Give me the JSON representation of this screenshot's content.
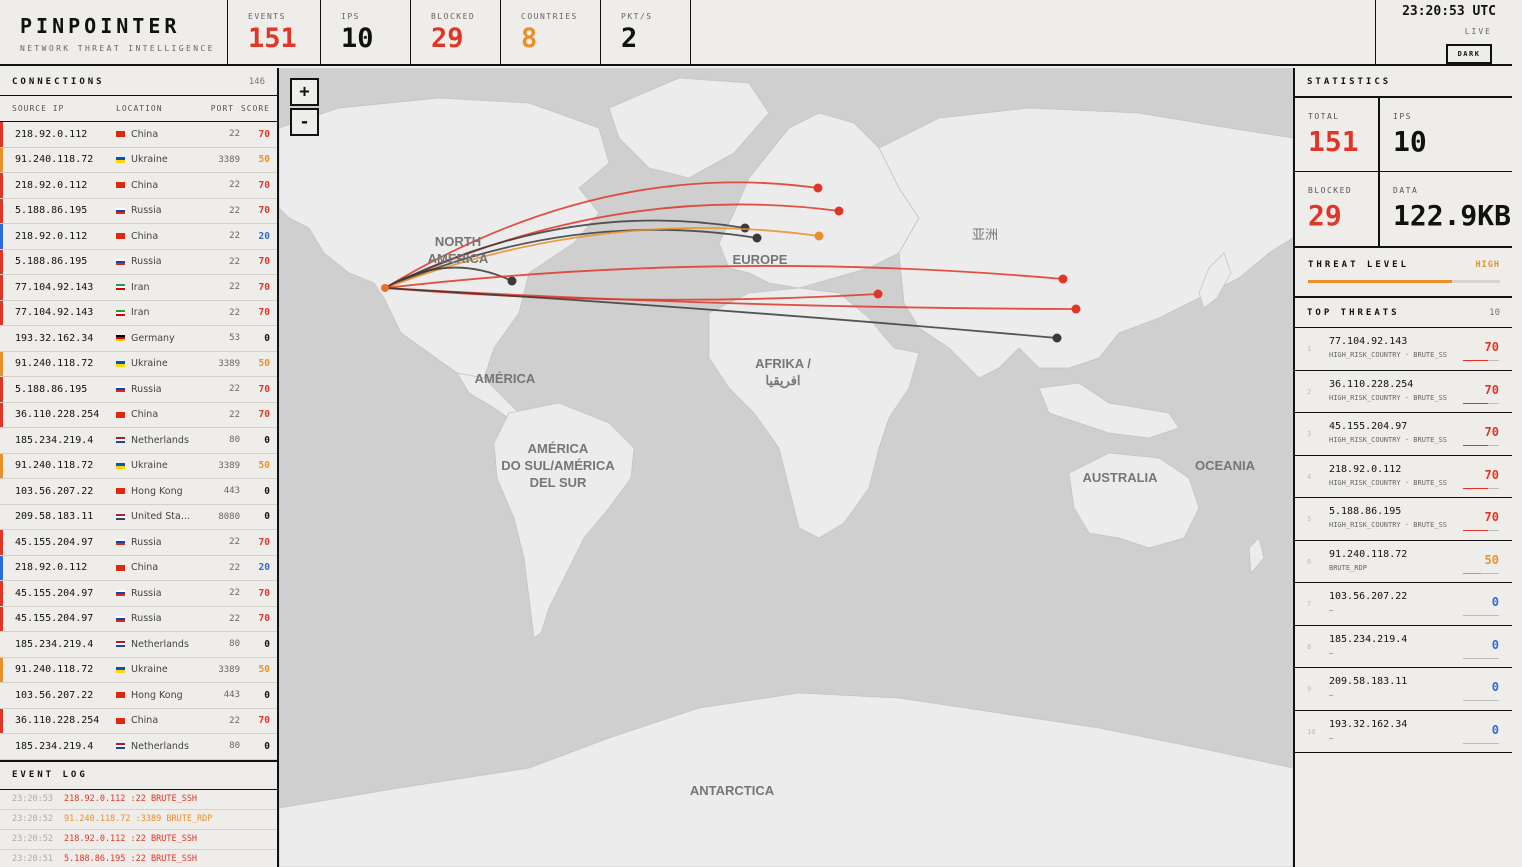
{
  "app": {
    "title": "PINPOINTER",
    "subtitle": "NETWORK THREAT INTELLIGENCE"
  },
  "header_stats": [
    {
      "label": "EVENTS",
      "value": "151",
      "color": "#e03527"
    },
    {
      "label": "IPS",
      "value": "10",
      "color": "#111111"
    },
    {
      "label": "BLOCKED",
      "value": "29",
      "color": "#e03527"
    },
    {
      "label": "COUNTRIES",
      "value": "8",
      "color": "#e8902a"
    },
    {
      "label": "PKT/S",
      "value": "2",
      "color": "#111111"
    }
  ],
  "clock": {
    "time": "23:20:53 UTC",
    "status": "LIVE",
    "theme_button": "DARK"
  },
  "connections": {
    "title": "CONNECTIONS",
    "count": "146",
    "columns": [
      "SOURCE IP",
      "LOCATION",
      "PORT",
      "SCORE"
    ],
    "rows": [
      {
        "ip": "218.92.0.112",
        "location": "China",
        "port": "22",
        "score": "70",
        "level": "high"
      },
      {
        "ip": "91.240.118.72",
        "location": "Ukraine",
        "port": "3389",
        "score": "50",
        "level": "med"
      },
      {
        "ip": "218.92.0.112",
        "location": "China",
        "port": "22",
        "score": "70",
        "level": "high"
      },
      {
        "ip": "5.188.86.195",
        "location": "Russia",
        "port": "22",
        "score": "70",
        "level": "high"
      },
      {
        "ip": "218.92.0.112",
        "location": "China",
        "port": "22",
        "score": "20",
        "level": "low"
      },
      {
        "ip": "5.188.86.195",
        "location": "Russia",
        "port": "22",
        "score": "70",
        "level": "high"
      },
      {
        "ip": "77.104.92.143",
        "location": "Iran",
        "port": "22",
        "score": "70",
        "level": "high"
      },
      {
        "ip": "77.104.92.143",
        "location": "Iran",
        "port": "22",
        "score": "70",
        "level": "high"
      },
      {
        "ip": "193.32.162.34",
        "location": "Germany",
        "port": "53",
        "score": "0",
        "level": "none"
      },
      {
        "ip": "91.240.118.72",
        "location": "Ukraine",
        "port": "3389",
        "score": "50",
        "level": "med"
      },
      {
        "ip": "5.188.86.195",
        "location": "Russia",
        "port": "22",
        "score": "70",
        "level": "high"
      },
      {
        "ip": "36.110.228.254",
        "location": "China",
        "port": "22",
        "score": "70",
        "level": "high"
      },
      {
        "ip": "185.234.219.4",
        "location": "Netherlands",
        "port": "80",
        "score": "0",
        "level": "none"
      },
      {
        "ip": "91.240.118.72",
        "location": "Ukraine",
        "port": "3389",
        "score": "50",
        "level": "med"
      },
      {
        "ip": "103.56.207.22",
        "location": "Hong Kong",
        "port": "443",
        "score": "0",
        "level": "none"
      },
      {
        "ip": "209.58.183.11",
        "location": "United Sta…",
        "port": "8080",
        "score": "0",
        "level": "none"
      },
      {
        "ip": "45.155.204.97",
        "location": "Russia",
        "port": "22",
        "score": "70",
        "level": "high"
      },
      {
        "ip": "218.92.0.112",
        "location": "China",
        "port": "22",
        "score": "20",
        "level": "low"
      },
      {
        "ip": "45.155.204.97",
        "location": "Russia",
        "port": "22",
        "score": "70",
        "level": "high"
      },
      {
        "ip": "45.155.204.97",
        "location": "Russia",
        "port": "22",
        "score": "70",
        "level": "high"
      },
      {
        "ip": "185.234.219.4",
        "location": "Netherlands",
        "port": "80",
        "score": "0",
        "level": "none"
      },
      {
        "ip": "91.240.118.72",
        "location": "Ukraine",
        "port": "3389",
        "score": "50",
        "level": "med"
      },
      {
        "ip": "103.56.207.22",
        "location": "Hong Kong",
        "port": "443",
        "score": "0",
        "level": "none"
      },
      {
        "ip": "36.110.228.254",
        "location": "China",
        "port": "22",
        "score": "70",
        "level": "high"
      },
      {
        "ip": "185.234.219.4",
        "location": "Netherlands",
        "port": "80",
        "score": "0",
        "level": "none"
      }
    ]
  },
  "event_log": {
    "title": "EVENT LOG",
    "rows": [
      {
        "time": "23:20:53",
        "text": "218.92.0.112 :22 BRUTE_SSH",
        "level": "high"
      },
      {
        "time": "23:20:52",
        "text": "91.240.118.72 :3389 BRUTE_RDP",
        "level": "med"
      },
      {
        "time": "23:20:52",
        "text": "218.92.0.112 :22 BRUTE_SSH",
        "level": "high"
      },
      {
        "time": "23:20:51",
        "text": "5.188.86.195 :22 BRUTE_SSH",
        "level": "high"
      }
    ]
  },
  "map": {
    "zoom_in": "+",
    "zoom_out": "-",
    "labels": {
      "north_america": [
        "NORTH",
        "AMERICA"
      ],
      "america": "AMÉRICA",
      "south_america": [
        "AMÉRICA",
        "DO SUL/AMÉRICA",
        "DEL SUR"
      ],
      "europe": "EUROPE",
      "africa": [
        "AFRIKA /",
        "افريقيا"
      ],
      "asia": "亚洲",
      "australia": "AUSTRALIA",
      "oceania": "OCEANIA",
      "antarctica": "ANTARCTICA"
    }
  },
  "statistics": {
    "title": "STATISTICS",
    "cells": [
      {
        "label": "TOTAL",
        "value": "151",
        "color": "#e03527"
      },
      {
        "label": "IPS",
        "value": "10",
        "color": "#111111"
      },
      {
        "label": "BLOCKED",
        "value": "29",
        "color": "#e03527"
      },
      {
        "label": "DATA",
        "value": "122.9KB",
        "color": "#111111"
      }
    ],
    "threat_level": {
      "label": "THREAT LEVEL",
      "value": "HIGH",
      "fill": 0.75,
      "color": "#e8902a"
    }
  },
  "top_threats": {
    "title": "TOP THREATS",
    "count": "10",
    "rows": [
      {
        "rank": "1",
        "ip": "77.104.92.143",
        "tags": "HIGH_RISK_COUNTRY · BRUTE_SSH",
        "score": "70",
        "level": "high"
      },
      {
        "rank": "2",
        "ip": "36.110.228.254",
        "tags": "HIGH_RISK_COUNTRY · BRUTE_SSH",
        "score": "70",
        "level": "high"
      },
      {
        "rank": "3",
        "ip": "45.155.204.97",
        "tags": "HIGH_RISK_COUNTRY · BRUTE_SSH",
        "score": "70",
        "level": "high"
      },
      {
        "rank": "4",
        "ip": "218.92.0.112",
        "tags": "HIGH_RISK_COUNTRY · BRUTE_SSH",
        "score": "70",
        "level": "high"
      },
      {
        "rank": "5",
        "ip": "5.188.86.195",
        "tags": "HIGH_RISK_COUNTRY · BRUTE_SSH",
        "score": "70",
        "level": "high"
      },
      {
        "rank": "6",
        "ip": "91.240.118.72",
        "tags": "BRUTE_RDP",
        "score": "50",
        "level": "med"
      },
      {
        "rank": "7",
        "ip": "103.56.207.22",
        "tags": "—",
        "score": "0",
        "level": "none"
      },
      {
        "rank": "8",
        "ip": "185.234.219.4",
        "tags": "—",
        "score": "0",
        "level": "none"
      },
      {
        "rank": "9",
        "ip": "209.58.183.11",
        "tags": "—",
        "score": "0",
        "level": "none"
      },
      {
        "rank": "10",
        "ip": "193.32.162.34",
        "tags": "—",
        "score": "0",
        "level": "none"
      }
    ]
  },
  "colors": {
    "high": "#e03527",
    "med": "#e8902a",
    "low": "#2c6bd8",
    "none": "#111111",
    "dark_arc": "#3a3a3a"
  }
}
